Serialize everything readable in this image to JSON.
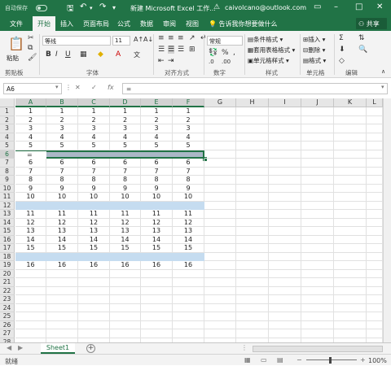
{
  "titlebar": {
    "autosave_label": "自动保存",
    "autosave_state": "off",
    "title": "新建 Microsoft Excel 工作...",
    "account": "caivolcano@outlook.com",
    "bg_color": "#217346"
  },
  "tabs": [
    {
      "label": "文件",
      "active": false
    },
    {
      "label": "开始",
      "active": true
    },
    {
      "label": "插入",
      "active": false
    },
    {
      "label": "页面布局",
      "active": false
    },
    {
      "label": "公式",
      "active": false
    },
    {
      "label": "数据",
      "active": false
    },
    {
      "label": "审阅",
      "active": false
    },
    {
      "label": "视图",
      "active": false
    }
  ],
  "tellme": "告诉我你想要做什么",
  "share_label": "共享",
  "ribbon": {
    "paste_label": "粘贴",
    "font_name": "等线",
    "font_size": "11",
    "number_format": "常规",
    "conditional_format": "条件格式",
    "table_format": "套用表格格式",
    "cell_style": "单元格样式",
    "insert": "插入",
    "delete": "删除",
    "format": "格式",
    "groups": [
      "剪贴板",
      "字体",
      "对齐方式",
      "数字",
      "样式",
      "单元格",
      "编辑"
    ]
  },
  "formula_bar": {
    "name_box": "A6",
    "fx": "fx",
    "content": "="
  },
  "columns": [
    "A",
    "B",
    "C",
    "D",
    "E",
    "F",
    "G",
    "H",
    "I",
    "J",
    "K",
    "L"
  ],
  "rows": [
    "1",
    "2",
    "3",
    "4",
    "5",
    "6",
    "7",
    "8",
    "9",
    "10",
    "11",
    "12",
    "13",
    "14",
    "15",
    "16",
    "17",
    "18",
    "19",
    "20",
    "21",
    "22",
    "23",
    "24",
    "25",
    "26",
    "27",
    "28"
  ],
  "cells": {
    "r1": [
      "1",
      "1",
      "1",
      "1",
      "1",
      "1"
    ],
    "r2": [
      "2",
      "2",
      "2",
      "2",
      "2",
      "2"
    ],
    "r3": [
      "3",
      "3",
      "3",
      "3",
      "3",
      "3"
    ],
    "r4": [
      "4",
      "4",
      "4",
      "4",
      "4",
      "4"
    ],
    "r5": [
      "5",
      "5",
      "5",
      "5",
      "5",
      "5"
    ],
    "r6": [
      "="
    ],
    "r7": [
      "6",
      "6",
      "6",
      "6",
      "6",
      "6"
    ],
    "r8": [
      "7",
      "7",
      "7",
      "7",
      "7",
      "7"
    ],
    "r9": [
      "8",
      "8",
      "8",
      "8",
      "8",
      "8"
    ],
    "r10": [
      "9",
      "9",
      "9",
      "9",
      "9",
      "9"
    ],
    "r11": [
      "10",
      "10",
      "10",
      "10",
      "10",
      "10"
    ],
    "r13": [
      "11",
      "11",
      "11",
      "11",
      "11",
      "11"
    ],
    "r14": [
      "12",
      "12",
      "12",
      "12",
      "12",
      "12"
    ],
    "r15": [
      "13",
      "13",
      "13",
      "13",
      "13",
      "13"
    ],
    "r16": [
      "14",
      "14",
      "14",
      "14",
      "14",
      "14"
    ],
    "r17": [
      "15",
      "15",
      "15",
      "15",
      "15",
      "15"
    ],
    "r19": [
      "16",
      "16",
      "16",
      "16",
      "16",
      "16"
    ]
  },
  "band_rows_blue": [
    12,
    18
  ],
  "band_row_selected": 6,
  "sheet_tab": "Sheet1",
  "status": "就绪",
  "zoom": "100%",
  "colors": {
    "excel_green": "#217346",
    "band_blue": "#c5dcf0",
    "band_gray": "#aab7c6"
  }
}
